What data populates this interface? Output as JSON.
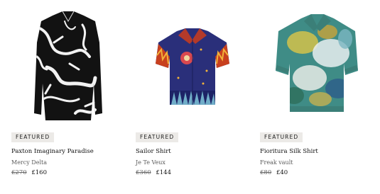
{
  "products": [
    {
      "badge": "FEATURED",
      "name": "Paxton Imaginary Paradise",
      "brand": "Mercy Delta",
      "old_price": "£270",
      "price": "£160",
      "image_icon": "black-white-abstract-shirt-image"
    },
    {
      "badge": "FEATURED",
      "name": "Sailor Shirt",
      "brand": "Je Te Veux",
      "old_price": "£360",
      "price": "£144",
      "image_icon": "navy-flame-print-shirt-image"
    },
    {
      "badge": "FEATURED",
      "name": "Fioritura Silk Shirt",
      "brand": "Freak vault",
      "old_price": "£80",
      "price": "£40",
      "image_icon": "teal-painted-silk-shirt-image"
    }
  ],
  "colors": {
    "badge_bg": "#eceae7",
    "text": "#111111",
    "muted": "#5a5a5a",
    "shirt1": "#111111",
    "shirt2": "#2a2f7a",
    "shirt3": "#3f8c86"
  }
}
